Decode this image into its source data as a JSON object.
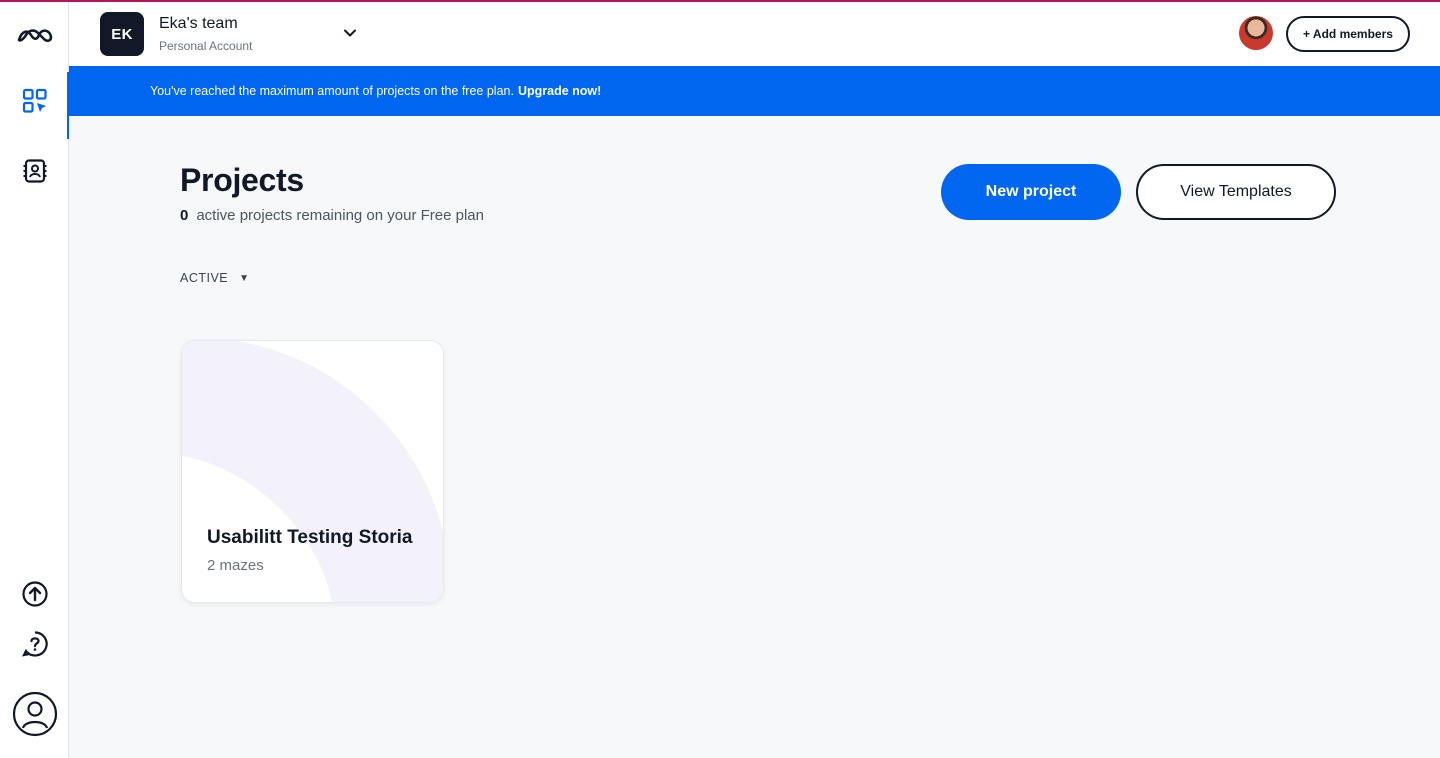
{
  "team": {
    "initials": "EK",
    "name": "Eka's team",
    "account_type": "Personal Account"
  },
  "header": {
    "add_members_label": "+ Add members"
  },
  "banner": {
    "message": "You've reached the maximum amount of projects on the free plan.",
    "upgrade_label": "Upgrade now!"
  },
  "main": {
    "title": "Projects",
    "remaining_count": "0",
    "remaining_text": "active projects remaining on your Free plan",
    "new_project_label": "New project",
    "view_templates_label": "View Templates",
    "filter_label": "ACTIVE"
  },
  "projects": [
    {
      "name": "Usabilitt Testing Storia",
      "mazes": "2 mazes"
    }
  ],
  "sidebar": {
    "items": [
      {
        "icon": "maze-logo-icon"
      },
      {
        "icon": "projects-grid-icon",
        "active": true
      },
      {
        "icon": "contacts-book-icon"
      },
      {
        "icon": "upgrade-arrow-icon"
      },
      {
        "icon": "help-icon"
      },
      {
        "icon": "user-profile-icon"
      }
    ]
  },
  "colors": {
    "accent": "#0066f0",
    "top_accent": "#b0185a",
    "dark": "#111827"
  }
}
